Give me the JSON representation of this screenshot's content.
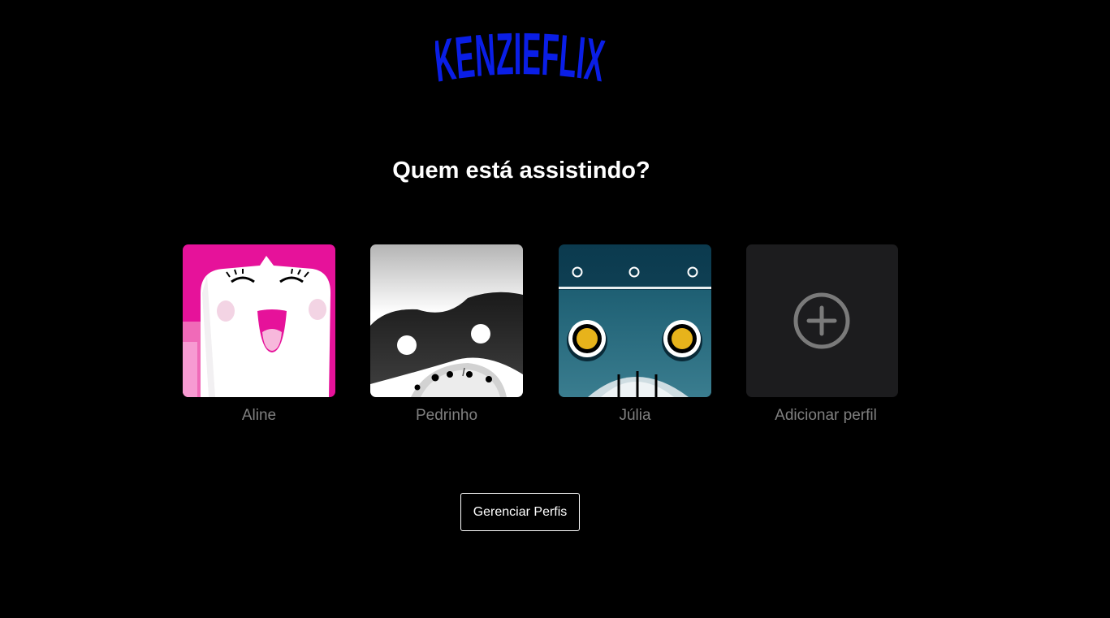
{
  "brand": {
    "logo_text": "KENZIEFLIX",
    "logo_color": "#0a1ee6"
  },
  "page": {
    "title": "Quem está assistindo?",
    "background": "#000000"
  },
  "profiles": [
    {
      "name": "Aline",
      "avatar": "pink-smiling-face-avatar"
    },
    {
      "name": "Pedrinho",
      "avatar": "raccoon-mask-avatar"
    },
    {
      "name": "Júlia",
      "avatar": "teal-robot-avatar"
    },
    {
      "name": "Adicionar perfil",
      "avatar": "add-plus-icon"
    }
  ],
  "actions": {
    "manage_profiles_label": "Gerenciar Perfis"
  },
  "colors": {
    "label_gray": "#808080",
    "add_tile": "#1c1c1e",
    "accent_blue": "#0a1ee6"
  }
}
